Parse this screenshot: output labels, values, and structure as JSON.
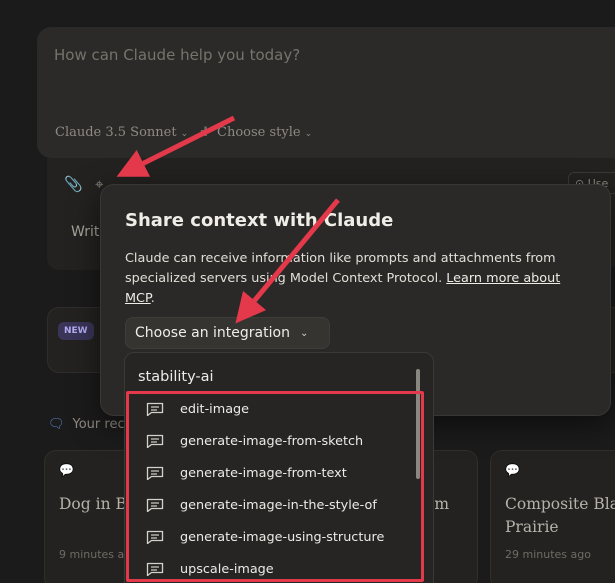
{
  "composer": {
    "placeholder": "How can Claude help you today?",
    "model_label": "Claude 3.5 Sonnet",
    "style_label": "Choose style",
    "write_text": "Writ",
    "use_label": "Use"
  },
  "news": {
    "badge": "NEW"
  },
  "recents": {
    "heading": "Your rec",
    "cards": [
      {
        "title": "Dog in Bl",
        "time": "9 minutes a"
      },
      {
        "title": "om",
        "time": ""
      },
      {
        "title": "Composite Blac Prairie",
        "time": "29 minutes ago"
      }
    ]
  },
  "dialog": {
    "title": "Share context with Claude",
    "body_text": "Claude can receive information like prompts and attachments from specialized servers using Model Context Protocol. ",
    "link_text": "Learn more about MCP",
    "body_end": ".",
    "choose_label": "Choose an integration"
  },
  "dropdown": {
    "server": "stability-ai",
    "tools": [
      "edit-image",
      "generate-image-from-sketch",
      "generate-image-from-text",
      "generate-image-in-the-style-of",
      "generate-image-using-structure",
      "upscale-image"
    ]
  },
  "colors": {
    "annotation_red": "#e3394b",
    "background": "#1b1b1b",
    "dialog": "#2a2927"
  }
}
